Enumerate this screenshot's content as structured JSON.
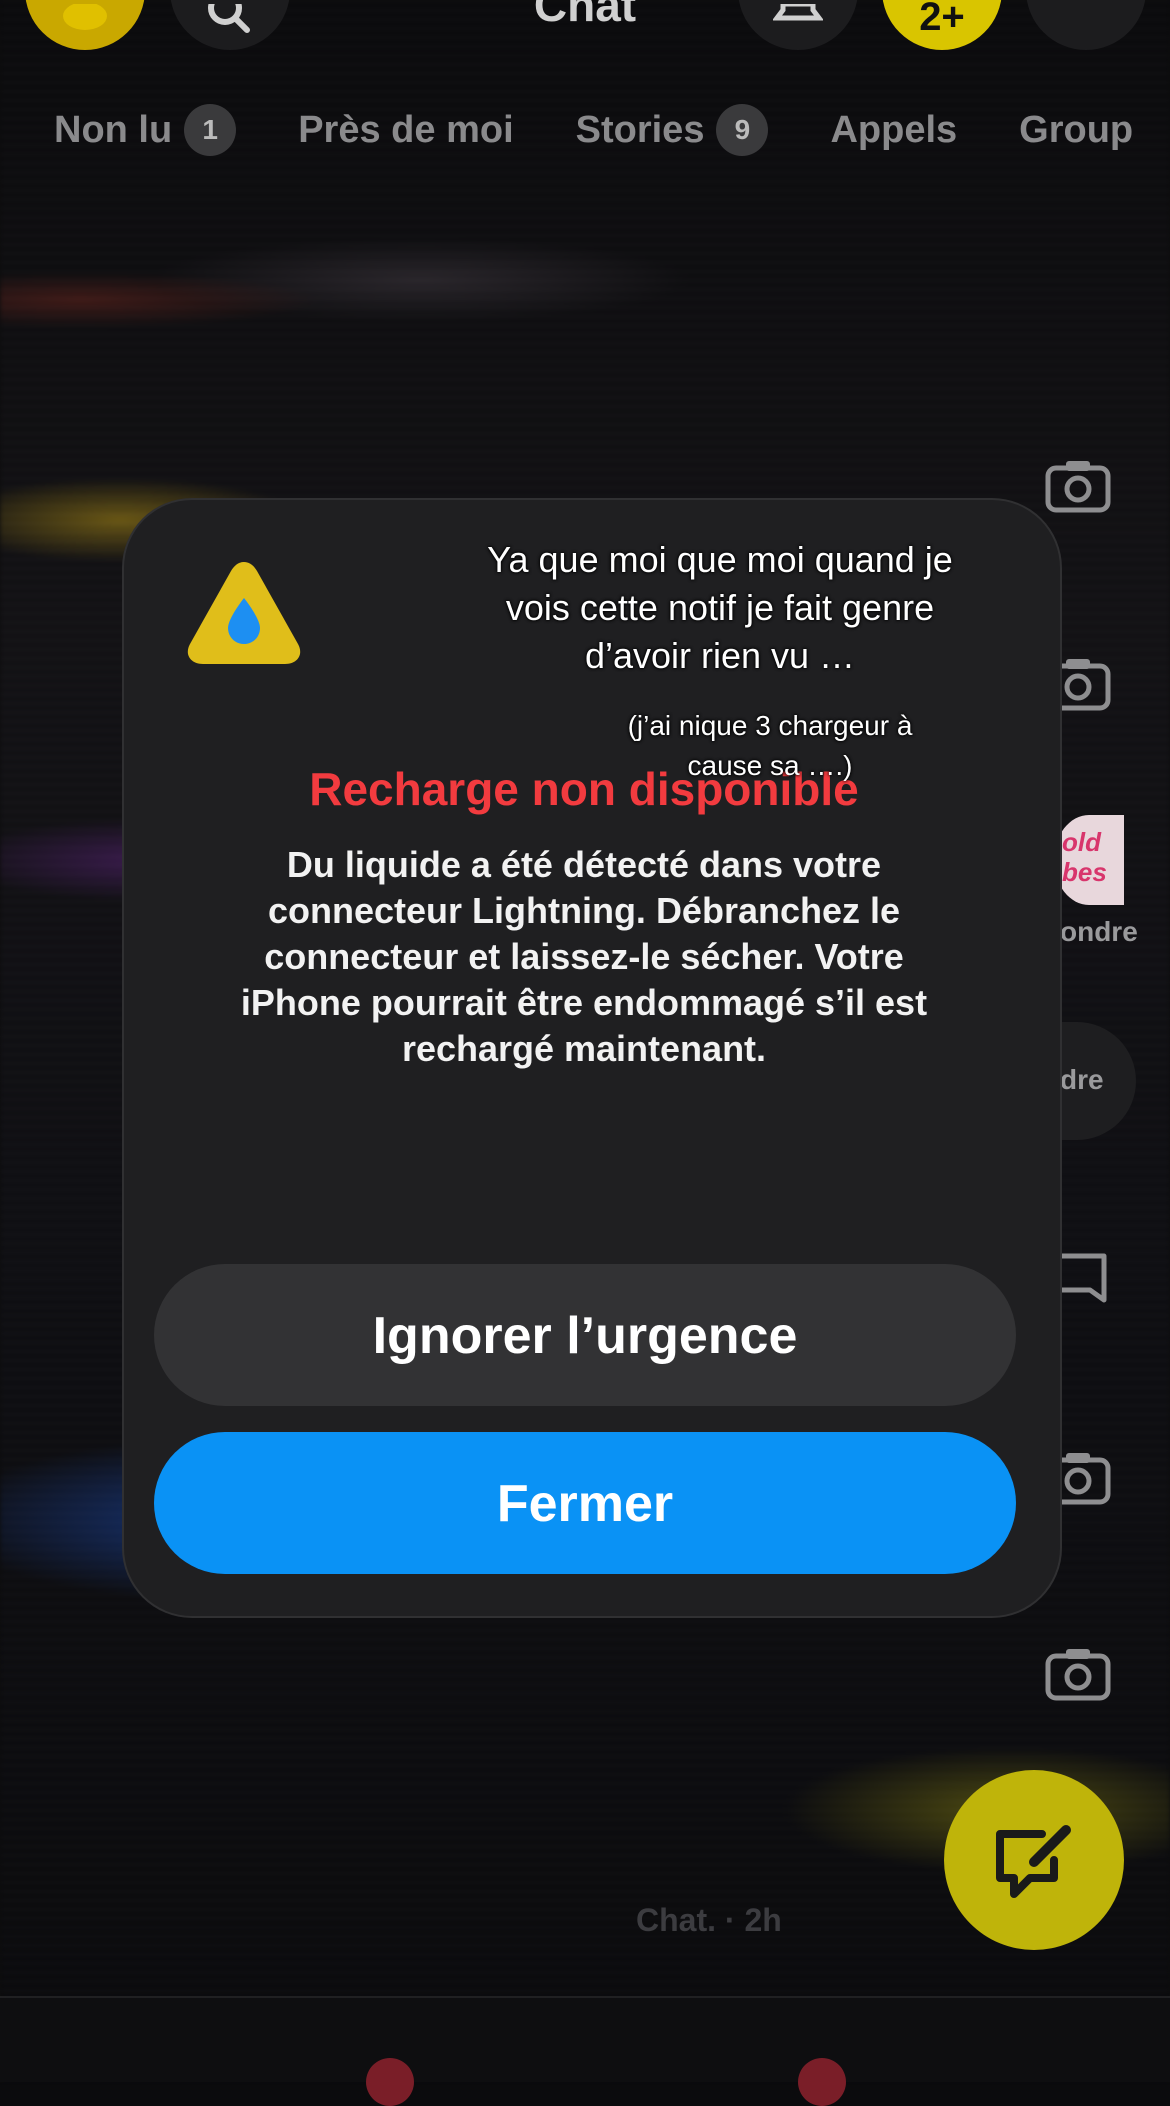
{
  "header": {
    "title": "Chat",
    "add_friend_label": "2+"
  },
  "tabs": [
    {
      "label": "Non lu",
      "badge": "1"
    },
    {
      "label": "Près de moi",
      "badge": ""
    },
    {
      "label": "Stories",
      "badge": "9"
    },
    {
      "label": "Appels",
      "badge": ""
    },
    {
      "label": "Group",
      "badge": ""
    }
  ],
  "list_partial": {
    "item_text_1": "ondre",
    "item_text_2": "dre",
    "avatar_text": "old bes",
    "faded_line": "Chat. · 2h"
  },
  "alert": {
    "title": "Recharge non disponible",
    "body": "Du liquide a été détecté dans votre connecteur Lightning. Débranchez le connecteur et laissez-le sécher. Votre iPhone pourrait être endommagé s’il est rechargé maintenant.",
    "ignore_label": "Ignorer l’urgence",
    "close_label": "Fermer"
  },
  "overlay": {
    "caption": "Ya que moi que moi quand je vois cette notif je fait genre d’avoir rien vu …",
    "caption_small": "(j’ai nique 3 chargeur à cause sa ….)"
  },
  "colors": {
    "alert_title": "#f23b3f",
    "primary_button": "#0a92f5",
    "secondary_button": "#323234",
    "accent_yellow": "#d9c500"
  }
}
